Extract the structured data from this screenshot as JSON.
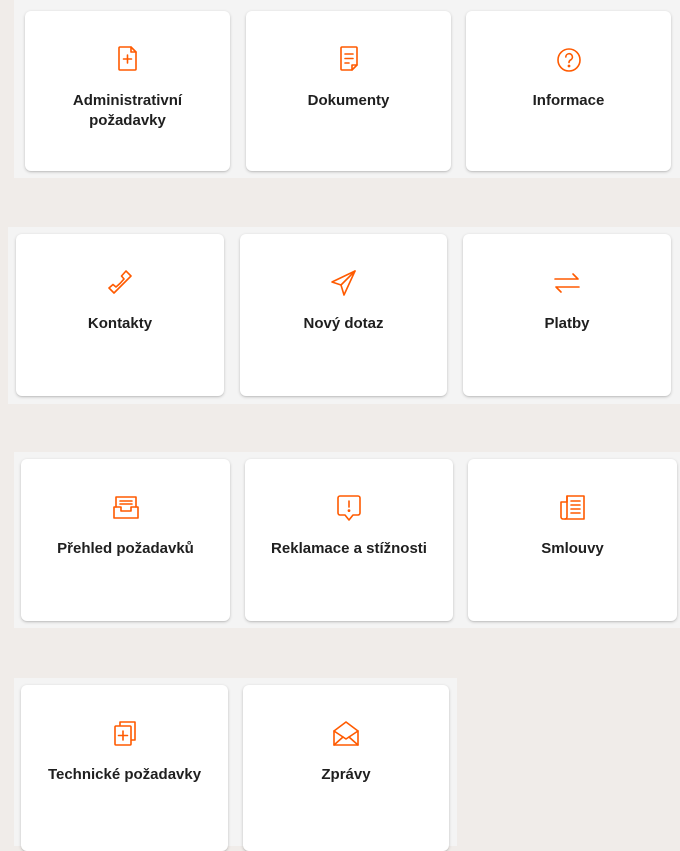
{
  "accent_color": "#ff5a00",
  "tiles": [
    {
      "label": "Administrativní požadavky",
      "icon": "document-plus-icon"
    },
    {
      "label": "Dokumenty",
      "icon": "document-lines-icon"
    },
    {
      "label": "Informace",
      "icon": "question-circle-icon"
    },
    {
      "label": "Kontakty",
      "icon": "phone-icon"
    },
    {
      "label": "Nový dotaz",
      "icon": "paper-plane-icon"
    },
    {
      "label": "Platby",
      "icon": "swap-arrows-icon"
    },
    {
      "label": "Přehled požadavků",
      "icon": "inbox-tray-icon"
    },
    {
      "label": "Reklamace a stížnosti",
      "icon": "message-alert-icon"
    },
    {
      "label": "Smlouvy",
      "icon": "contract-pages-icon"
    },
    {
      "label": "Technické požadavky",
      "icon": "copy-plus-icon"
    },
    {
      "label": "Zprávy",
      "icon": "envelope-open-icon"
    }
  ]
}
